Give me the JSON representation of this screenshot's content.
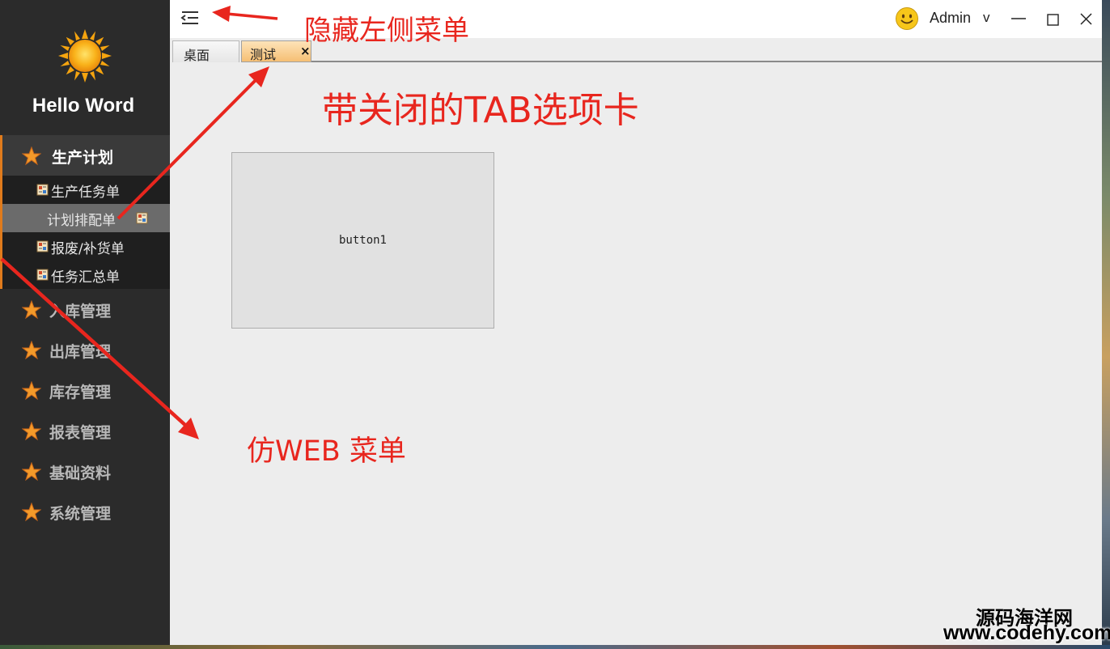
{
  "app": {
    "title": "Hello Word"
  },
  "sidebar": {
    "groups": [
      {
        "label": "生产计划",
        "icon": "star-icon",
        "expanded": true,
        "items": [
          {
            "label": "生产任务单",
            "icon": "form-icon"
          },
          {
            "label": "计划排配单",
            "icon": "form-icon",
            "selected": true
          },
          {
            "label": "报废/补货单",
            "icon": "form-icon"
          },
          {
            "label": "任务汇总单",
            "icon": "form-icon"
          }
        ]
      },
      {
        "label": "入库管理",
        "icon": "star-icon"
      },
      {
        "label": "出库管理",
        "icon": "star-icon"
      },
      {
        "label": "库存管理",
        "icon": "star-icon"
      },
      {
        "label": "报表管理",
        "icon": "star-icon"
      },
      {
        "label": "基础资料",
        "icon": "star-icon"
      },
      {
        "label": "系统管理",
        "icon": "star-icon"
      }
    ]
  },
  "header": {
    "user": {
      "name": "Admin",
      "caret": "v",
      "avatar_icon": "smiley-icon"
    }
  },
  "tabs": [
    {
      "label": "桌面",
      "closable": false
    },
    {
      "label": "测试",
      "closable": true,
      "close_glyph": "×",
      "active": true
    }
  ],
  "content": {
    "button_label": "button1"
  },
  "annotations": {
    "hide_menu": "隐藏左侧菜单",
    "closable_tabs": "带关闭的TAB选项卡",
    "web_menu": "仿WEB 菜单"
  },
  "watermark": {
    "line1": "源码海洋网",
    "line2": "www.codehy.com"
  },
  "colors": {
    "accent": "#e07b1c",
    "sidebar_bg": "#2b2b2b",
    "annotation": "#e8261e",
    "active_tab": "#f6bf74"
  }
}
